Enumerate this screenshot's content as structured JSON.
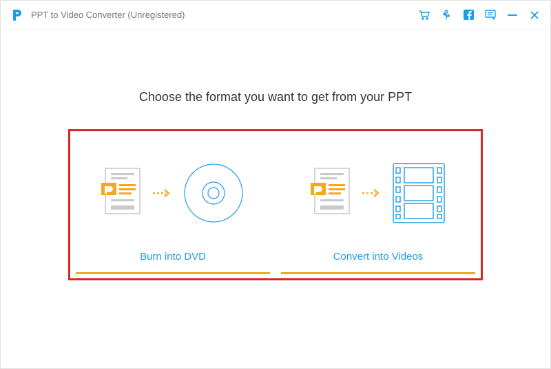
{
  "window": {
    "title": "PPT to Video Converter (Unregistered)"
  },
  "titlebar_icons": {
    "cart": "cart-icon",
    "usb": "usb-icon",
    "facebook": "facebook-icon",
    "feedback": "feedback-icon",
    "minimize": "minimize-icon",
    "close": "close-icon"
  },
  "main": {
    "heading": "Choose the format you want to get from your PPT",
    "options": [
      {
        "label": "Burn into DVD"
      },
      {
        "label": "Convert into Videos"
      }
    ]
  },
  "colors": {
    "accent": "#1d9cec",
    "highlight": "#d4272a",
    "warm": "#f5a623"
  }
}
